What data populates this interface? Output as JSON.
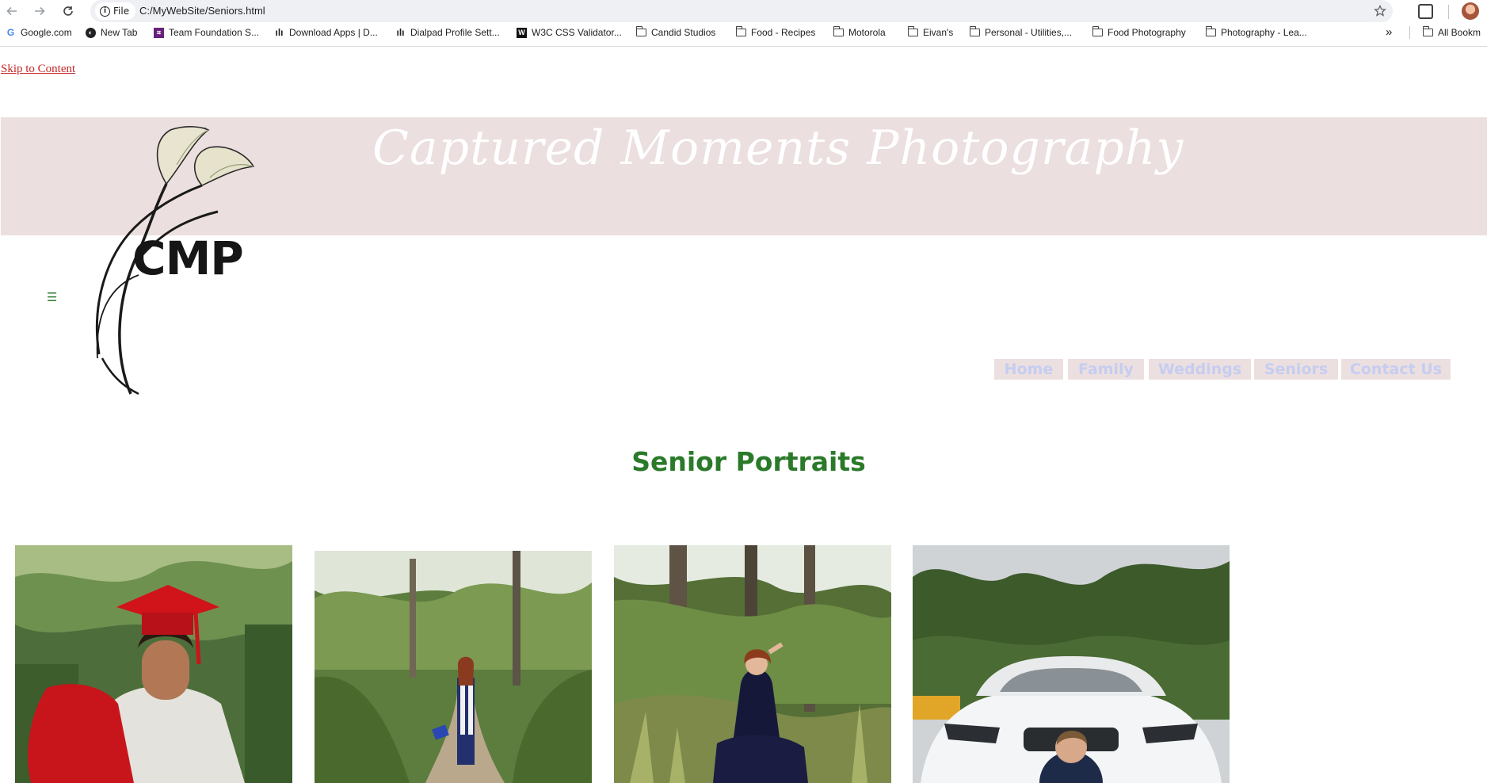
{
  "browser": {
    "back_icon": "arrow-left-icon",
    "forward_icon": "arrow-right-icon",
    "reload_icon": "reload-icon",
    "chip_label": "File",
    "url": "C:/MyWebSite/Seniors.html",
    "star_icon": "star-icon",
    "extensions_icon": "puzzle-icon",
    "profile_icon": "avatar-icon"
  },
  "bookmarks": {
    "items": [
      {
        "label": "Google.com",
        "icon": "google-icon"
      },
      {
        "label": "New Tab",
        "icon": "globe-icon"
      },
      {
        "label": "Team Foundation S...",
        "icon": "visual-studio-icon"
      },
      {
        "label": "Download Apps | D...",
        "icon": "dialpad-icon"
      },
      {
        "label": "Dialpad Profile Sett...",
        "icon": "dialpad-icon"
      },
      {
        "label": "W3C CSS Validator...",
        "icon": "w3c-icon"
      },
      {
        "label": "Candid Studios",
        "icon": "folder-icon"
      },
      {
        "label": "Food - Recipes",
        "icon": "folder-icon"
      },
      {
        "label": "Motorola",
        "icon": "folder-icon"
      },
      {
        "label": "Eivan's",
        "icon": "folder-icon"
      },
      {
        "label": "Personal - Utilities,...",
        "icon": "folder-icon"
      },
      {
        "label": "Food Photography",
        "icon": "folder-icon"
      },
      {
        "label": "Photography - Lea...",
        "icon": "folder-icon"
      }
    ],
    "overflow": "»",
    "all_bookmarks": "All Bookm"
  },
  "page": {
    "skip_link": "Skip to Content",
    "site_title": "Captured Moments Photography",
    "logo_text": "CMP",
    "hamburger": "☰",
    "nav": [
      "Home",
      "Family",
      "Weddings",
      "Seniors",
      "Contact Us"
    ],
    "heading": "Senior Portraits"
  },
  "colors": {
    "banner": "#ecdfe0",
    "nav_text": "#c5cdf0",
    "heading": "#2a7a2a",
    "skip_link": "#c62828"
  }
}
